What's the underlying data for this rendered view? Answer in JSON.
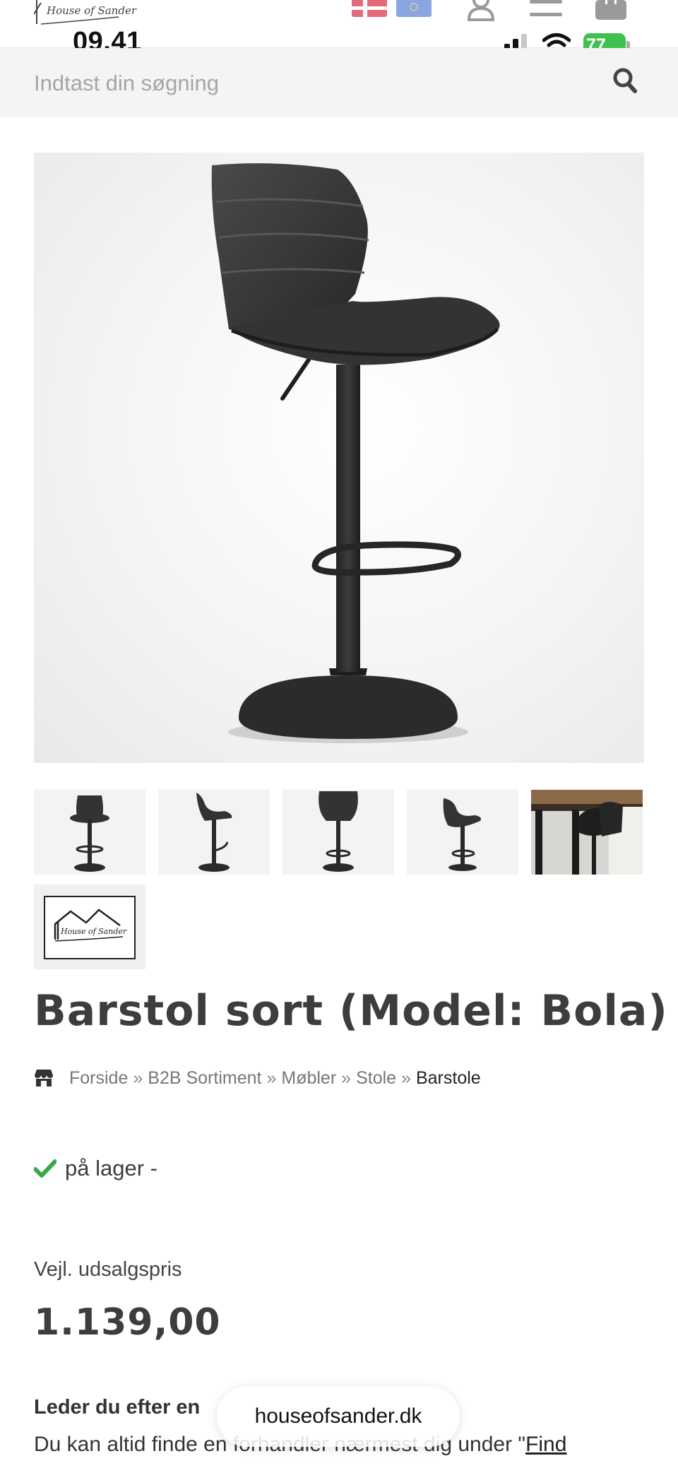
{
  "status_bar": {
    "time": "09.41",
    "battery_percent": "77"
  },
  "header": {
    "logo_text": "HOUSE OF SANDER",
    "icons": [
      "logo-icon",
      "danish-flag-icon",
      "eu-flag-icon",
      "user-icon",
      "menu-icon",
      "cart-icon"
    ]
  },
  "search": {
    "placeholder": "Indtast din søgning",
    "value": ""
  },
  "product": {
    "title": "Barstol sort (Model: Bola)",
    "thumbnail_count": 6,
    "stock_text": "på lager -",
    "price_label": "Vejl. udsalgspris",
    "price": "1.139,00"
  },
  "breadcrumb": {
    "items": [
      "Forside",
      "B2B Sortiment",
      "Møbler",
      "Stole"
    ],
    "current": "Barstole",
    "separator": "»"
  },
  "dealer": {
    "heading": "Leder du efter en",
    "text": "Du kan altid finde en forhandler nærmest dig under \"",
    "link": "Find forhandler",
    "suffix": "\""
  },
  "browser": {
    "url": "houseofsander.dk"
  },
  "colors": {
    "accent_green": "#3ec24f",
    "stock_check": "#3aa845",
    "text_dark": "#3d3d3d",
    "search_bg": "#f4f4f4"
  }
}
